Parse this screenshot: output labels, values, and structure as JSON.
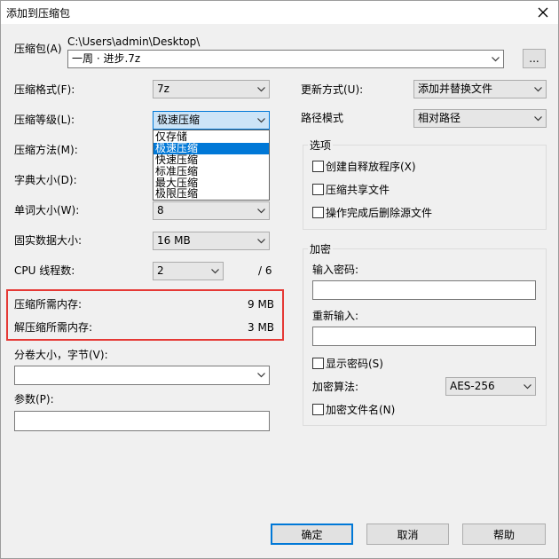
{
  "window": {
    "title": "添加到压缩包"
  },
  "archive": {
    "label": "压缩包(A)",
    "path": "C:\\Users\\admin\\Desktop\\",
    "name": "一周 · 进步.7z",
    "browse_label": "..."
  },
  "left": {
    "format": {
      "label": "压缩格式(F):",
      "value": "7z"
    },
    "level": {
      "label": "压缩等级(L):",
      "value": "极速压缩"
    },
    "level_options": [
      "仅存储",
      "极速压缩",
      "快速压缩",
      "标准压缩",
      "最大压缩",
      "极限压缩"
    ],
    "method": {
      "label": "压缩方法(M):"
    },
    "dict": {
      "label": "字典大小(D):"
    },
    "word": {
      "label": "单词大小(W):",
      "value": "8"
    },
    "solid": {
      "label": "固实数据大小:",
      "value": "16 MB"
    },
    "cpu": {
      "label": "CPU 线程数:",
      "value": "2",
      "total": "/ 6"
    },
    "mem_compress": {
      "label": "压缩所需内存:",
      "value": "9 MB"
    },
    "mem_decompress": {
      "label": "解压缩所需内存:",
      "value": "3 MB"
    },
    "volume": {
      "label": "分卷大小，字节(V):"
    },
    "params": {
      "label": "参数(P):"
    }
  },
  "right": {
    "update": {
      "label": "更新方式(U):",
      "value": "添加并替换文件"
    },
    "pathmode": {
      "label": "路径模式",
      "value": "相对路径"
    },
    "options": {
      "title": "选项",
      "sfx": "创建自释放程序(X)",
      "shared": "压缩共享文件",
      "delete": "操作完成后删除源文件"
    },
    "encryption": {
      "title": "加密",
      "password_label": "输入密码:",
      "reenter_label": "重新输入:",
      "show_password": "显示密码(S)",
      "method_label": "加密算法:",
      "method_value": "AES-256",
      "encrypt_names": "加密文件名(N)"
    }
  },
  "buttons": {
    "ok": "确定",
    "cancel": "取消",
    "help": "帮助"
  }
}
